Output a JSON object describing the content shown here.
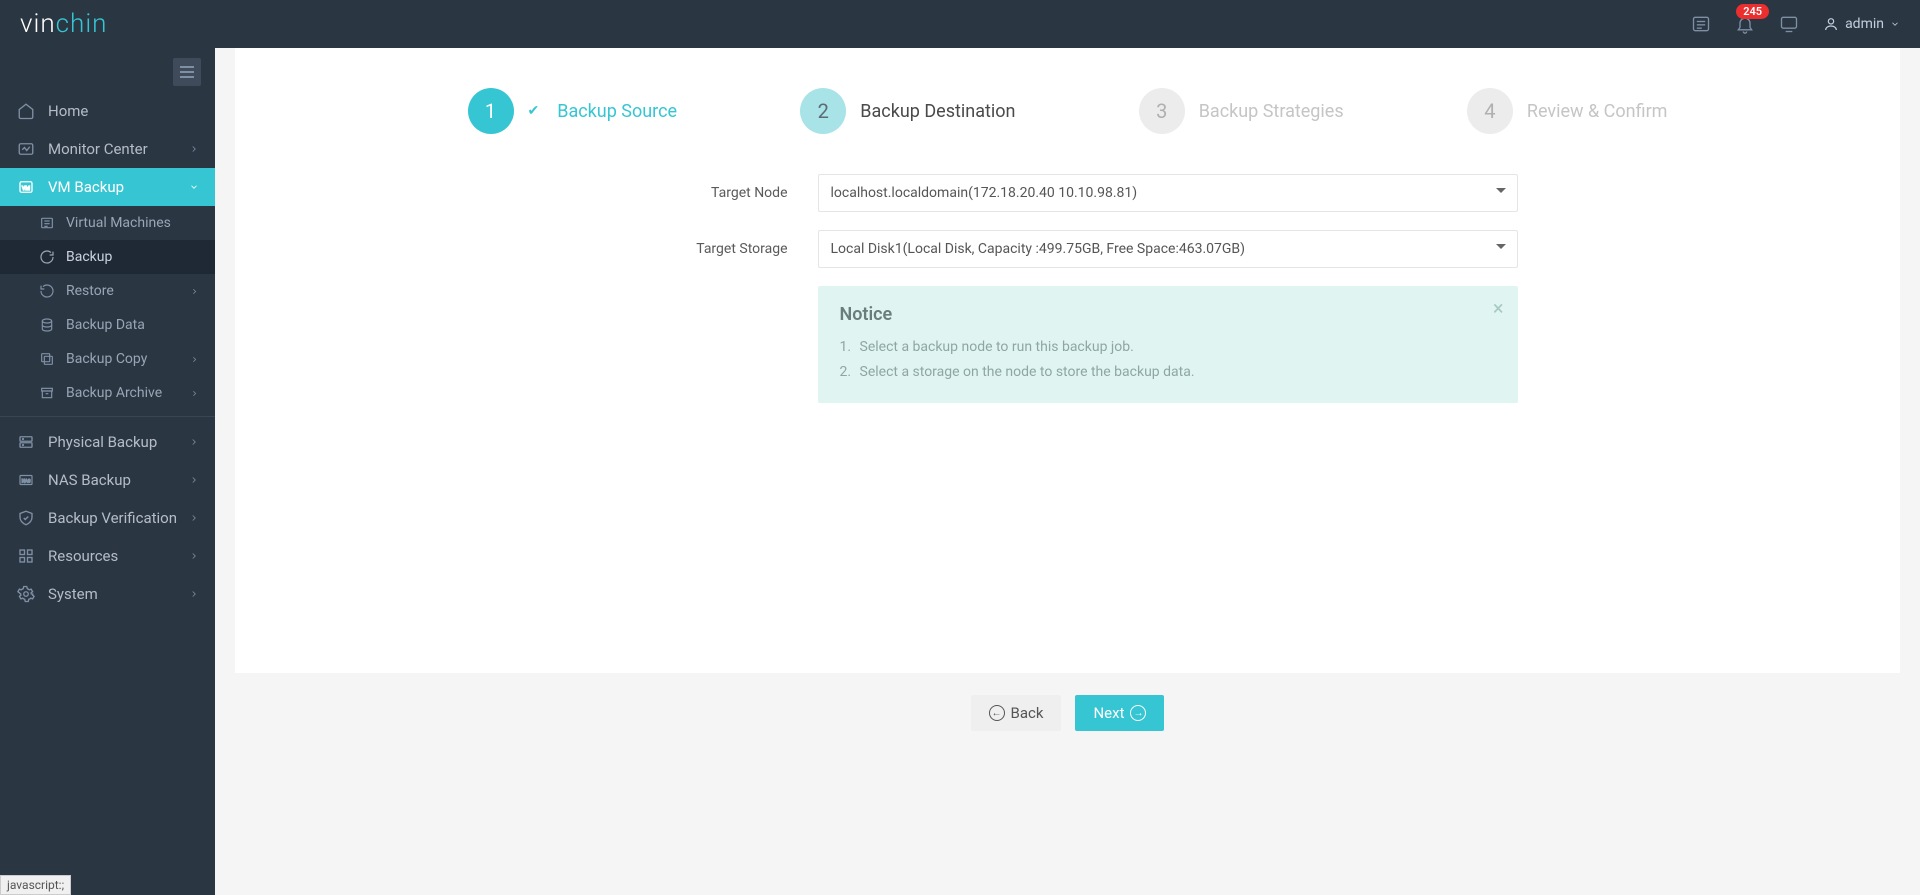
{
  "brand": {
    "part1": "vin",
    "part2": "chin"
  },
  "topbar": {
    "badge": "245",
    "user": "admin"
  },
  "sidebar": {
    "home": "Home",
    "monitor": "Monitor Center",
    "vmbackup": "VM Backup",
    "vmbackup_sub": {
      "virtual_machines": "Virtual Machines",
      "backup": "Backup",
      "restore": "Restore",
      "backup_data": "Backup Data",
      "backup_copy": "Backup Copy",
      "backup_archive": "Backup Archive"
    },
    "physical": "Physical Backup",
    "nas": "NAS Backup",
    "verification": "Backup Verification",
    "resources": "Resources",
    "system": "System"
  },
  "steps": {
    "s1": {
      "num": "1",
      "label": "Backup Source"
    },
    "s2": {
      "num": "2",
      "label": "Backup Destination"
    },
    "s3": {
      "num": "3",
      "label": "Backup Strategies"
    },
    "s4": {
      "num": "4",
      "label": "Review & Confirm"
    }
  },
  "form": {
    "target_node_label": "Target Node",
    "target_node_value": "localhost.localdomain(172.18.20.40 10.10.98.81)",
    "target_storage_label": "Target Storage",
    "target_storage_value": "Local Disk1(Local Disk, Capacity :499.75GB, Free Space:463.07GB)"
  },
  "notice": {
    "title": "Notice",
    "line1": "Select a backup node to run this backup job.",
    "line2": "Select a storage on the node to store the backup data."
  },
  "buttons": {
    "back": "Back",
    "next": "Next"
  },
  "status_url": "javascript:;"
}
